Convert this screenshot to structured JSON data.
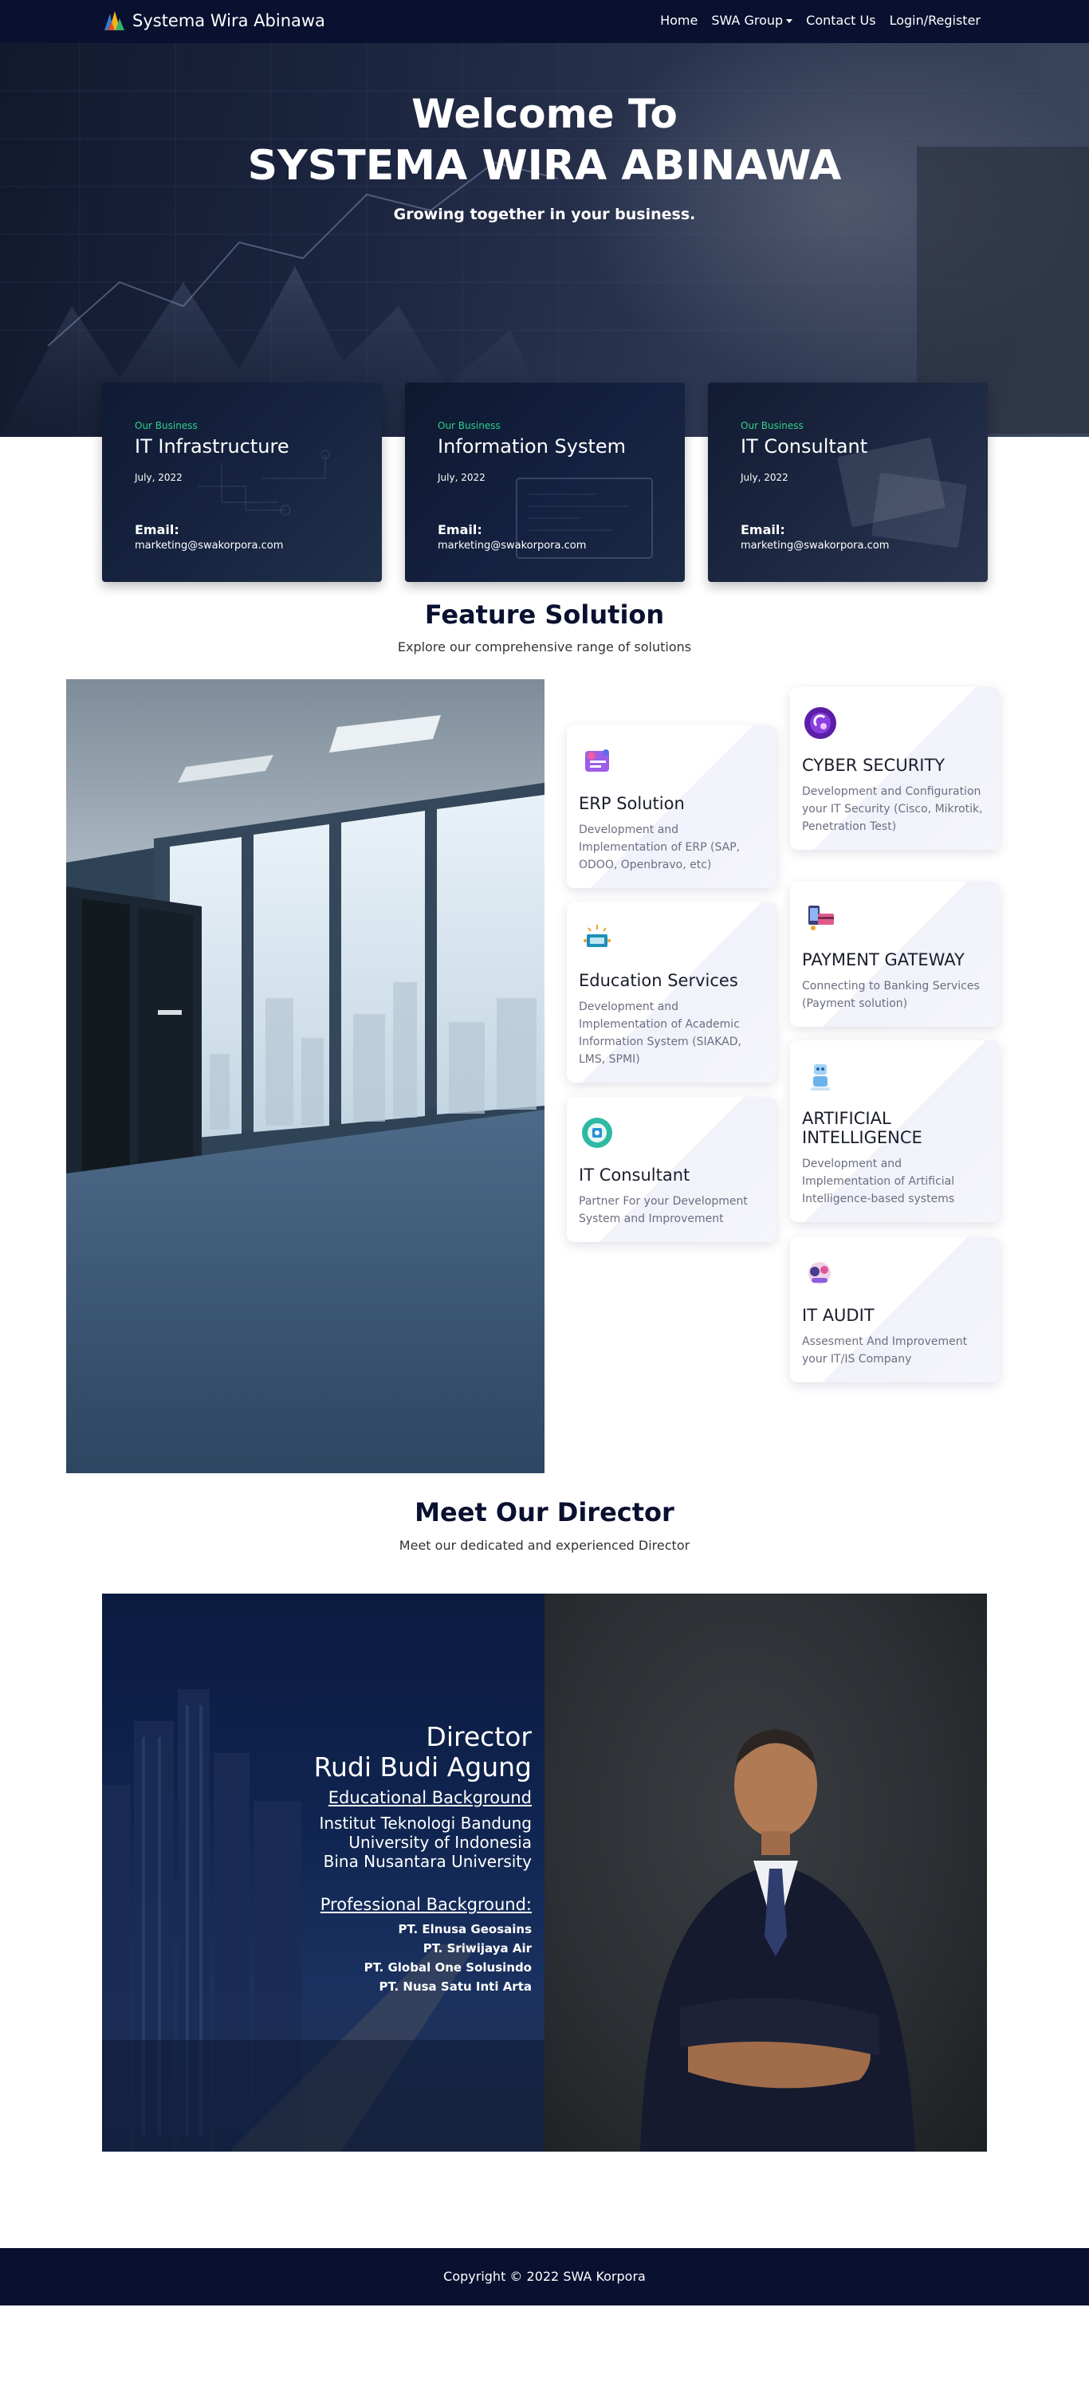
{
  "nav": {
    "brand": "Systema Wira Abinawa",
    "links": [
      "Home",
      "SWA Group",
      "Contact Us",
      "Login/Register"
    ]
  },
  "hero": {
    "title_line1": "Welcome To",
    "title_line2": "SYSTEMA WIRA ABINAWA",
    "subtitle": "Growing together in your business."
  },
  "business_cards": [
    {
      "tag": "Our Business",
      "title": "IT Infrastructure",
      "date": "July, 2022",
      "email_label": "Email:",
      "email": "marketing@swakorpora.com"
    },
    {
      "tag": "Our Business",
      "title": "Information System",
      "date": "July, 2022",
      "email_label": "Email:",
      "email": "marketing@swakorpora.com"
    },
    {
      "tag": "Our Business",
      "title": "IT Consultant",
      "date": "July, 2022",
      "email_label": "Email:",
      "email": "marketing@swakorpora.com"
    }
  ],
  "features": {
    "title": "Feature Solution",
    "subtitle": "Explore our comprehensive range of solutions",
    "services": [
      {
        "title": "ERP Solution",
        "desc": "Development and Implementation of ERP (SAP, ODOO, Openbravo, etc)",
        "icon": "erp-icon"
      },
      {
        "title": "Education Services",
        "desc": "Development and Implementation of Academic Information System (SIAKAD, LMS, SPMI)",
        "icon": "education-icon"
      },
      {
        "title": "IT Consultant",
        "desc": "Partner For your Development System and Improvement",
        "icon": "consultant-icon"
      },
      {
        "title": "CYBER SECURITY",
        "desc": "Development and Configuration your IT Security (Cisco, Mikrotik, Penetration Test)",
        "icon": "cyber-security-icon"
      },
      {
        "title": "PAYMENT GATEWAY",
        "desc": "Connecting to Banking Services (Payment solution)",
        "icon": "payment-icon"
      },
      {
        "title": "ARTIFICIAL INTELLIGENCE",
        "desc": "Development and Implementation of Artificial Intelligence-based systems",
        "icon": "ai-icon"
      },
      {
        "title": "IT AUDIT",
        "desc": "Assesment And Improvement your IT/IS Company",
        "icon": "audit-icon"
      }
    ]
  },
  "director": {
    "title": "Meet Our Director",
    "subtitle": "Meet our dedicated and experienced Director",
    "role": "Director",
    "name": "Rudi Budi Agung",
    "edu_heading": "Educational Background",
    "education": [
      "Institut Teknologi Bandung",
      "University of Indonesia",
      "Bina Nusantara University"
    ],
    "pro_heading": "Professional Background:",
    "professional": [
      "PT. Elnusa Geosains",
      "PT. Sriwijaya Air",
      "PT. Global One Solusindo",
      "PT. Nusa Satu Inti Arta"
    ]
  },
  "footer": {
    "copyright": "Copyright © 2022 SWA Korpora"
  },
  "colors": {
    "navy": "#0a1030",
    "accent_green": "#2fd08a"
  }
}
